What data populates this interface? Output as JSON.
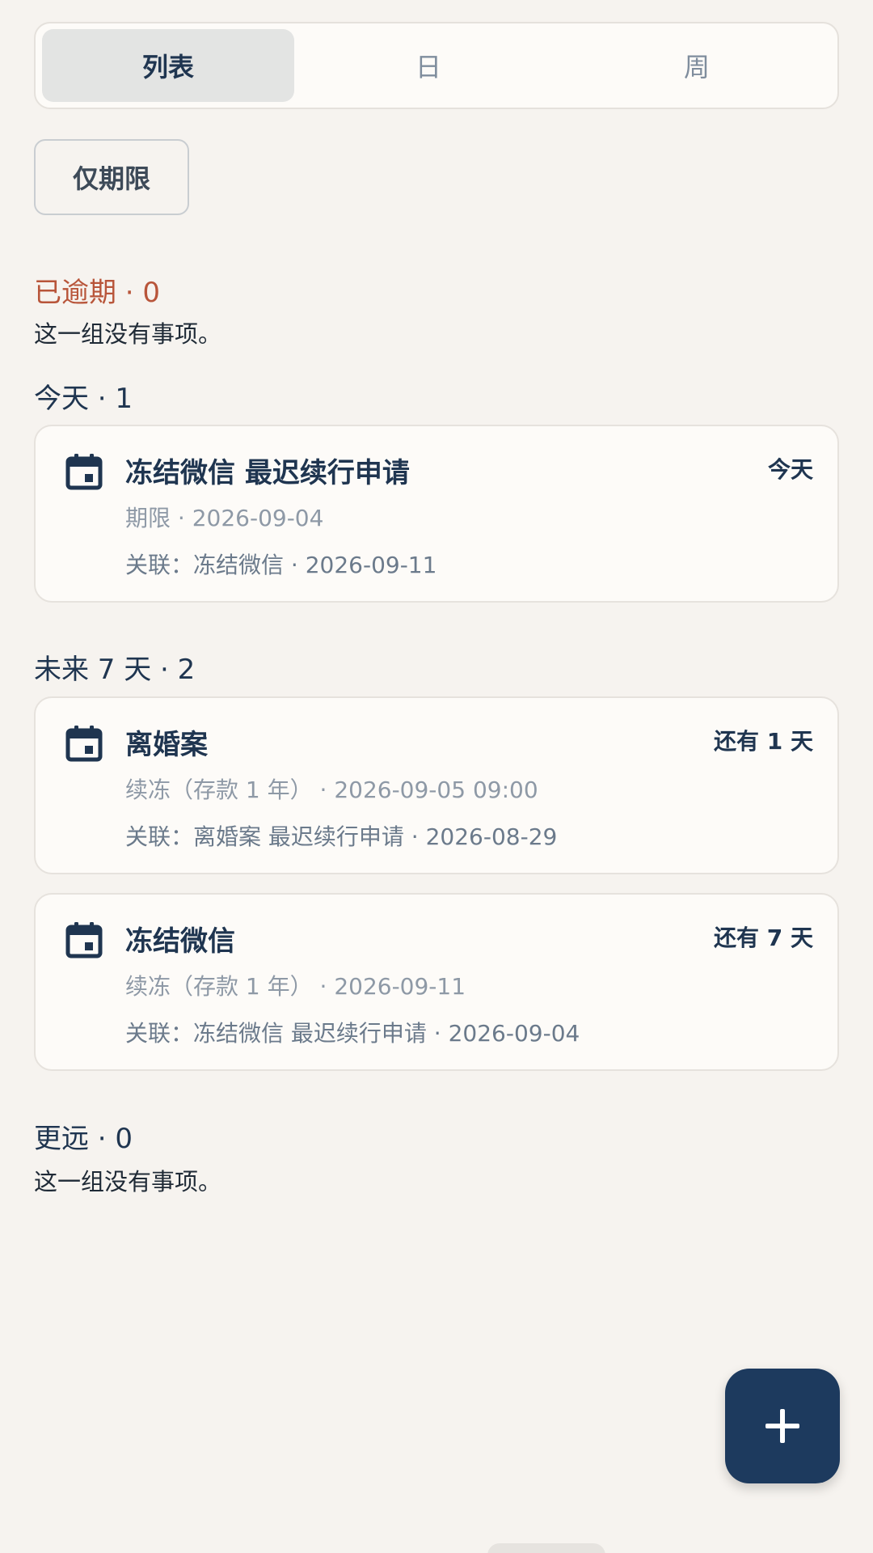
{
  "tabs": [
    {
      "label": "列表",
      "active": true
    },
    {
      "label": "日",
      "active": false
    },
    {
      "label": "周",
      "active": false
    }
  ],
  "filter": {
    "label": "仅期限"
  },
  "groups": {
    "overdue": {
      "header": "已逾期 · 0",
      "empty_note": "这一组没有事项。"
    },
    "today": {
      "header": "今天 · 1"
    },
    "next7": {
      "header": "未来 7 天 · 2"
    },
    "later": {
      "header": "更远 · 0",
      "empty_note": "这一组没有事项。"
    }
  },
  "cards": [
    {
      "icon": "calendar-icon",
      "title": "冻结微信 最迟续行申请",
      "badge": "今天",
      "line1": "期限 · 2026-09-04",
      "line2": "关联：冻结微信 · 2026-09-11"
    },
    {
      "icon": "calendar-icon",
      "title": "离婚案",
      "badge": "还有 1 天",
      "line1": "续冻（存款 1 年） · 2026-09-05 09:00",
      "line2": "关联：离婚案 最迟续行申请 · 2026-08-29"
    },
    {
      "icon": "calendar-icon",
      "title": "冻结微信",
      "badge": "还有 7 天",
      "line1": "续冻（存款 1 年） · 2026-09-11",
      "line2": "关联：冻结微信 最迟续行申请 · 2026-09-04"
    }
  ],
  "fab": {
    "icon": "plus-icon"
  },
  "colors": {
    "background": "#f6f3ef",
    "primary": "#1d3a5e",
    "overdue": "#b8553a",
    "card": "#fdfbf8"
  }
}
